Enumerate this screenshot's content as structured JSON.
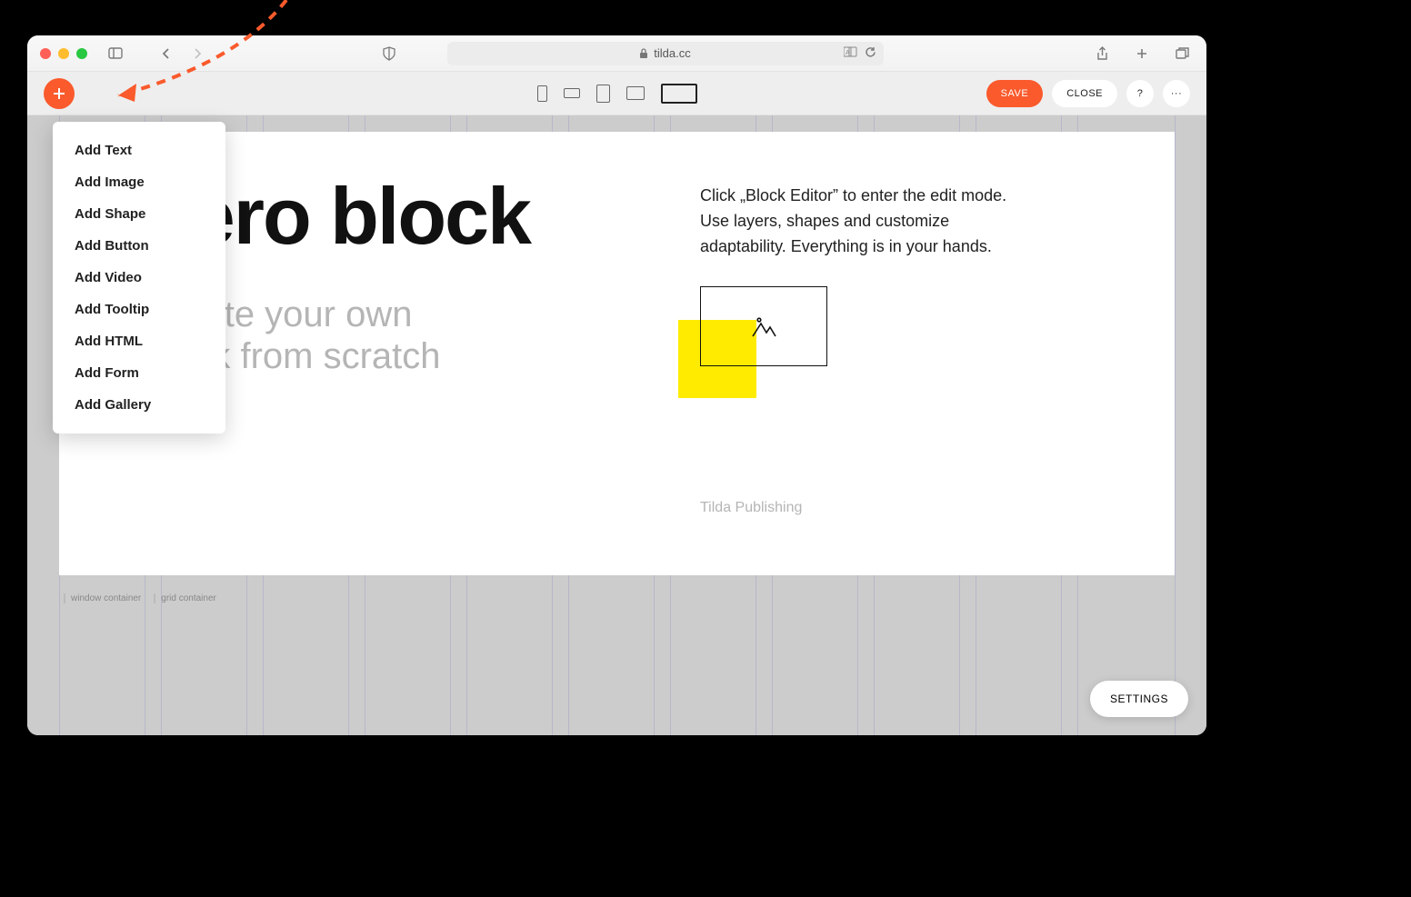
{
  "browser": {
    "url_host": "tilda.cc"
  },
  "toolbar": {
    "save_label": "SAVE",
    "close_label": "CLOSE",
    "help_label": "?",
    "more_label": "···"
  },
  "add_menu": {
    "items": [
      {
        "label": "Add Text"
      },
      {
        "label": "Add Image"
      },
      {
        "label": "Add Shape"
      },
      {
        "label": "Add Button"
      },
      {
        "label": "Add Video"
      },
      {
        "label": "Add Tooltip"
      },
      {
        "label": "Add HTML"
      },
      {
        "label": "Add Form"
      },
      {
        "label": "Add Gallery"
      }
    ]
  },
  "page": {
    "hero_title": "Zero block",
    "hero_subtitle_line1": "Create your own",
    "hero_subtitle_line2": "block from scratch",
    "description": "Click „Block Editor” to enter the edit mode. Use layers, shapes and customize adaptability. Everything is in your hands.",
    "credit": "Tilda Publishing"
  },
  "containers": {
    "window_label": "window container",
    "grid_label": "grid container"
  },
  "settings_label": "SETTINGS",
  "colors": {
    "accent": "#fa5a2c",
    "highlight": "#ffeb00"
  }
}
